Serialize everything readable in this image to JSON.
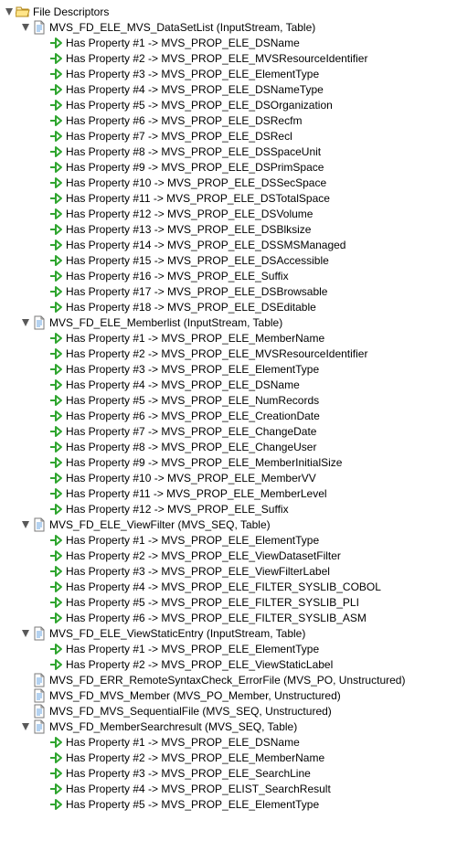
{
  "root": {
    "label": "File Descriptors"
  },
  "nodes": [
    {
      "label": "MVS_FD_ELE_MVS_DataSetList (InputStream, Table)",
      "open": true,
      "props": [
        "Has Property #1 -> MVS_PROP_ELE_DSName",
        "Has Property #2 -> MVS_PROP_ELE_MVSResourceIdentifier",
        "Has Property #3 -> MVS_PROP_ELE_ElementType",
        "Has Property #4 -> MVS_PROP_ELE_DSNameType",
        "Has Property #5 -> MVS_PROP_ELE_DSOrganization",
        "Has Property #6 -> MVS_PROP_ELE_DSRecfm",
        "Has Property #7 -> MVS_PROP_ELE_DSRecl",
        "Has Property #8 -> MVS_PROP_ELE_DSSpaceUnit",
        "Has Property #9 -> MVS_PROP_ELE_DSPrimSpace",
        "Has Property #10 -> MVS_PROP_ELE_DSSecSpace",
        "Has Property #11 -> MVS_PROP_ELE_DSTotalSpace",
        "Has Property #12 -> MVS_PROP_ELE_DSVolume",
        "Has Property #13 -> MVS_PROP_ELE_DSBlksize",
        "Has Property #14 -> MVS_PROP_ELE_DSSMSManaged",
        "Has Property #15 -> MVS_PROP_ELE_DSAccessible",
        "Has Property #16 -> MVS_PROP_ELE_Suffix",
        "Has Property #17 -> MVS_PROP_ELE_DSBrowsable",
        "Has Property #18 -> MVS_PROP_ELE_DSEditable"
      ]
    },
    {
      "label": "MVS_FD_ELE_Memberlist (InputStream, Table)",
      "open": true,
      "props": [
        "Has Property #1 -> MVS_PROP_ELE_MemberName",
        "Has Property #2 -> MVS_PROP_ELE_MVSResourceIdentifier",
        "Has Property #3 -> MVS_PROP_ELE_ElementType",
        "Has Property #4 -> MVS_PROP_ELE_DSName",
        "Has Property #5 -> MVS_PROP_ELE_NumRecords",
        "Has Property #6 -> MVS_PROP_ELE_CreationDate",
        "Has Property #7 -> MVS_PROP_ELE_ChangeDate",
        "Has Property #8 -> MVS_PROP_ELE_ChangeUser",
        "Has Property #9 -> MVS_PROP_ELE_MemberInitialSize",
        "Has Property #10 -> MVS_PROP_ELE_MemberVV",
        "Has Property #11 -> MVS_PROP_ELE_MemberLevel",
        "Has Property #12 -> MVS_PROP_ELE_Suffix"
      ]
    },
    {
      "label": "MVS_FD_ELE_ViewFilter (MVS_SEQ, Table)",
      "open": true,
      "props": [
        "Has Property #1 -> MVS_PROP_ELE_ElementType",
        "Has Property #2 -> MVS_PROP_ELE_ViewDatasetFilter",
        "Has Property #3 -> MVS_PROP_ELE_ViewFilterLabel",
        "Has Property #4 -> MVS_PROP_ELE_FILTER_SYSLIB_COBOL",
        "Has Property #5 -> MVS_PROP_ELE_FILTER_SYSLIB_PLI",
        "Has Property #6 -> MVS_PROP_ELE_FILTER_SYSLIB_ASM"
      ]
    },
    {
      "label": "MVS_FD_ELE_ViewStaticEntry (InputStream, Table)",
      "open": true,
      "props": [
        "Has Property #1 -> MVS_PROP_ELE_ElementType",
        "Has Property #2 -> MVS_PROP_ELE_ViewStaticLabel"
      ]
    },
    {
      "label": "MVS_FD_ERR_RemoteSyntaxCheck_ErrorFile (MVS_PO, Unstructured)",
      "open": false,
      "props": []
    },
    {
      "label": "MVS_FD_MVS_Member (MVS_PO_Member, Unstructured)",
      "open": false,
      "props": []
    },
    {
      "label": "MVS_FD_MVS_SequentialFile (MVS_SEQ, Unstructured)",
      "open": false,
      "props": []
    },
    {
      "label": "MVS_FD_MemberSearchresult (MVS_SEQ, Table)",
      "open": true,
      "props": [
        "Has Property #1 -> MVS_PROP_ELE_DSName",
        "Has Property #2 -> MVS_PROP_ELE_MemberName",
        "Has Property #3 -> MVS_PROP_ELE_SearchLine",
        "Has Property #4 -> MVS_PROP_ELIST_SearchResult",
        "Has Property #5 -> MVS_PROP_ELE_ElementType"
      ]
    }
  ]
}
